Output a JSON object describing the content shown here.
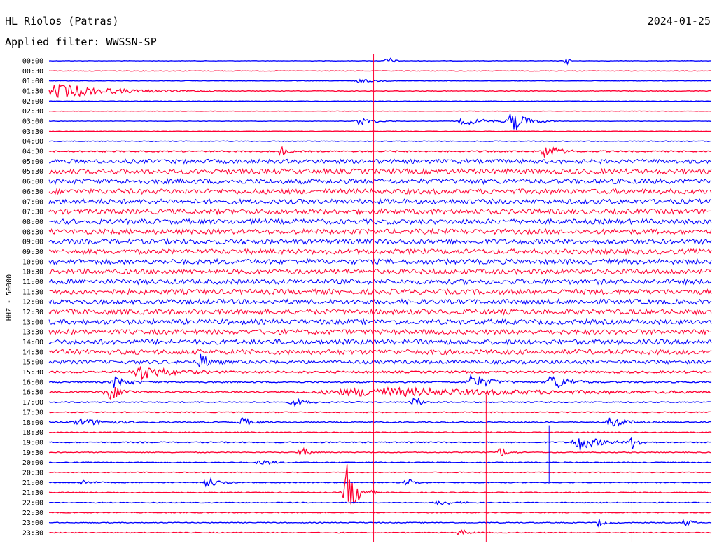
{
  "header": {
    "station": "HL Riolos (Patras)",
    "date": "2024-01-25",
    "filter": "Applied filter: WWSSN-SP"
  },
  "chart_data": {
    "type": "line",
    "ylabel": "HHZ - 50000",
    "row_labels": [
      "00:00",
      "00:30",
      "01:00",
      "01:30",
      "02:00",
      "02:30",
      "03:00",
      "03:30",
      "04:00",
      "04:30",
      "05:00",
      "05:30",
      "06:00",
      "06:30",
      "07:00",
      "07:30",
      "08:00",
      "08:30",
      "09:00",
      "09:30",
      "10:00",
      "10:30",
      "11:00",
      "11:30",
      "12:00",
      "12:30",
      "13:00",
      "13:30",
      "14:00",
      "14:30",
      "15:00",
      "15:30",
      "16:00",
      "16:30",
      "17:00",
      "17:30",
      "18:00",
      "18:30",
      "19:00",
      "19:30",
      "20:00",
      "20:30",
      "21:00",
      "21:30",
      "22:00",
      "22:30",
      "23:00",
      "23:30"
    ],
    "trace_colors": [
      "#0000ff",
      "#ff0033"
    ],
    "row_amplitude": [
      0.3,
      0.4,
      0.3,
      0.5,
      0.3,
      0.3,
      0.3,
      0.3,
      0.5,
      1.0,
      3.0,
      3.5,
      3.5,
      3.5,
      3.5,
      3.5,
      3.5,
      3.5,
      3.5,
      3.5,
      3.5,
      3.5,
      3.5,
      3.5,
      3.5,
      3.5,
      3.5,
      3.5,
      3.5,
      3.5,
      2.5,
      1.5,
      1.0,
      1.2,
      0.8,
      0.7,
      0.8,
      0.6,
      0.8,
      0.6,
      0.6,
      0.6,
      0.6,
      0.6,
      0.6,
      0.6,
      0.6,
      0.6
    ],
    "events": [
      {
        "row": 0,
        "x": 0.51,
        "amp": 8,
        "width": 0.004
      },
      {
        "row": 0,
        "x": 0.78,
        "amp": 10,
        "width": 0.002
      },
      {
        "row": 2,
        "x": 0.47,
        "amp": 3,
        "width": 0.01
      },
      {
        "row": 3,
        "x": 0.02,
        "amp": 10,
        "width": 0.04
      },
      {
        "row": 6,
        "x": 0.47,
        "amp": 6,
        "width": 0.01
      },
      {
        "row": 6,
        "x": 0.63,
        "amp": 5,
        "width": 0.02
      },
      {
        "row": 6,
        "x": 0.7,
        "amp": 14,
        "width": 0.012
      },
      {
        "row": 9,
        "x": 0.35,
        "amp": 8,
        "width": 0.004
      },
      {
        "row": 9,
        "x": 0.75,
        "amp": 10,
        "width": 0.01
      },
      {
        "row": 30,
        "x": 0.23,
        "amp": 12,
        "width": 0.006
      },
      {
        "row": 31,
        "x": 0.14,
        "amp": 10,
        "width": 0.02
      },
      {
        "row": 32,
        "x": 0.1,
        "amp": 8,
        "width": 0.01
      },
      {
        "row": 32,
        "x": 0.64,
        "amp": 12,
        "width": 0.012
      },
      {
        "row": 32,
        "x": 0.76,
        "amp": 12,
        "width": 0.012
      },
      {
        "row": 33,
        "x": 0.09,
        "amp": 12,
        "width": 0.01
      },
      {
        "row": 33,
        "x": 0.5,
        "amp": 6,
        "width": 0.12
      },
      {
        "row": 34,
        "x": 0.55,
        "amp": 9,
        "width": 0.006
      },
      {
        "row": 34,
        "x": 0.37,
        "amp": 5,
        "width": 0.01
      },
      {
        "row": 36,
        "x": 0.05,
        "amp": 5,
        "width": 0.02
      },
      {
        "row": 36,
        "x": 0.29,
        "amp": 7,
        "width": 0.008
      },
      {
        "row": 36,
        "x": 0.85,
        "amp": 9,
        "width": 0.01
      },
      {
        "row": 38,
        "x": 0.8,
        "amp": 12,
        "width": 0.015
      },
      {
        "row": 38,
        "x": 0.88,
        "amp": 10,
        "width": 0.006
      },
      {
        "row": 39,
        "x": 0.38,
        "amp": 8,
        "width": 0.006
      },
      {
        "row": 39,
        "x": 0.68,
        "amp": 8,
        "width": 0.006
      },
      {
        "row": 40,
        "x": 0.32,
        "amp": 4,
        "width": 0.01
      },
      {
        "row": 42,
        "x": 0.05,
        "amp": 4,
        "width": 0.008
      },
      {
        "row": 42,
        "x": 0.24,
        "amp": 8,
        "width": 0.008
      },
      {
        "row": 42,
        "x": 0.54,
        "amp": 6,
        "width": 0.006
      },
      {
        "row": 43,
        "x": 0.45,
        "amp": 40,
        "width": 0.008
      },
      {
        "row": 44,
        "x": 0.59,
        "amp": 4,
        "width": 0.01
      },
      {
        "row": 46,
        "x": 0.83,
        "amp": 5,
        "width": 0.006
      },
      {
        "row": 46,
        "x": 0.96,
        "amp": 8,
        "width": 0.004
      },
      {
        "row": 47,
        "x": 0.62,
        "amp": 6,
        "width": 0.006
      }
    ],
    "spikes": [
      {
        "x": 0.49,
        "from_row": 0,
        "to_row": 47
      },
      {
        "x": 0.66,
        "from_row": 34,
        "to_row": 47
      },
      {
        "x": 0.755,
        "from_row": 37,
        "to_row": 41
      },
      {
        "x": 0.88,
        "from_row": 37,
        "to_row": 47
      }
    ]
  }
}
